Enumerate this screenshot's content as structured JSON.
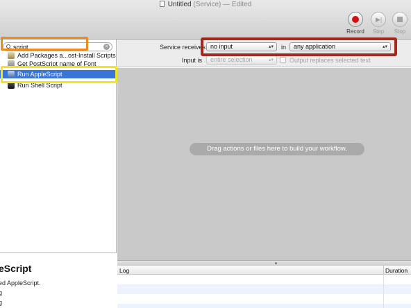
{
  "window": {
    "title": "Untitled",
    "subtitle": "(Service) — Edited"
  },
  "toolbar": {
    "record_label": "Record",
    "step_label": "Step",
    "stop_label": "Stop"
  },
  "colors": {
    "highlight_orange": "#ec8b1f",
    "highlight_yellow": "#f1e61d",
    "highlight_red": "#a12a1c",
    "selection_blue": "#3875d7"
  },
  "library": {
    "search": {
      "value": "script",
      "placeholder": "Name"
    },
    "results": [
      {
        "label": "Add Packages a...ost-Install Scripts",
        "icon": "package-icon",
        "selected": false
      },
      {
        "label": "Get PostScript name of Font",
        "icon": "font-icon",
        "selected": false
      },
      {
        "label": "Run AppleScript",
        "icon": "applescript-icon",
        "selected": true
      },
      {
        "label": "Run Shell Script",
        "icon": "terminal-icon",
        "selected": false
      }
    ],
    "description": {
      "title": "eScript",
      "text": "ed AppleScript.",
      "line1": "g",
      "line2": "g"
    }
  },
  "workflow": {
    "service_receives_label": "Service receives",
    "input_type": "no input",
    "in_label": "in",
    "application": "any application",
    "input_is_label": "Input is",
    "input_is_value": "entire selection",
    "output_replaces_label": "Output replaces selected text",
    "drop_hint": "Drag actions or files here to build your workflow."
  },
  "log": {
    "columns": [
      "Log",
      "Duration"
    ]
  }
}
